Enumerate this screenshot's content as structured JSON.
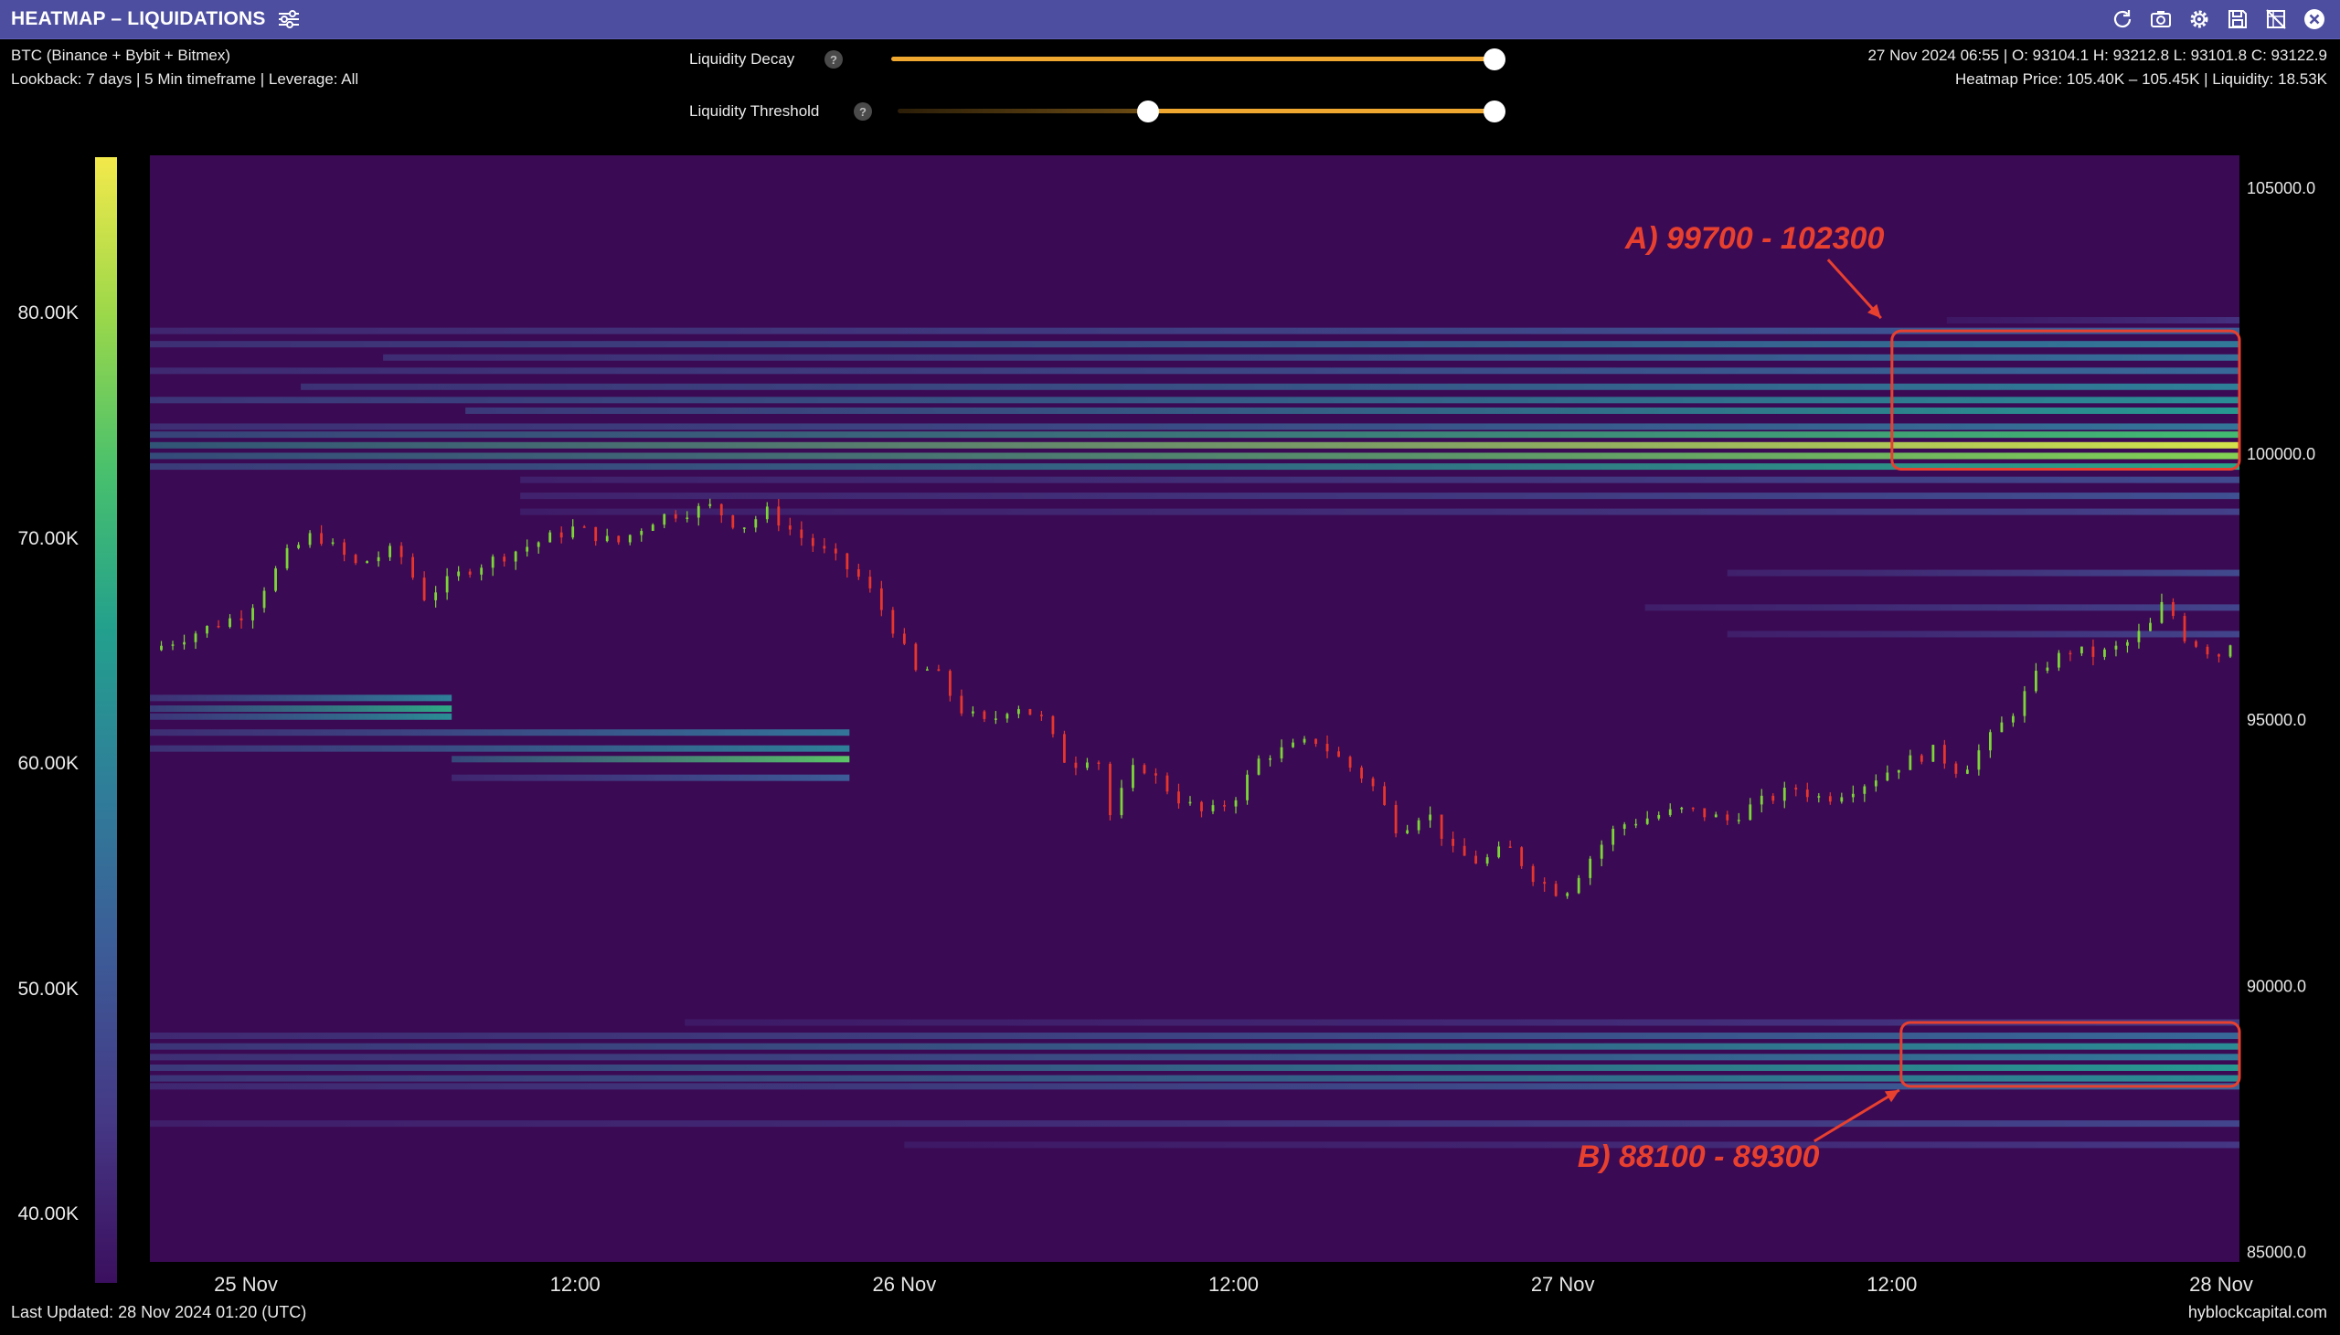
{
  "window": {
    "title": "HEATMAP – LIQUIDATIONS",
    "toolbar_icons": [
      "refresh-icon",
      "camera-icon",
      "gear-icon",
      "save-icon",
      "no-grid-icon",
      "close-icon"
    ],
    "accent_color": "#4d4ea0"
  },
  "info": {
    "exchanges": "BTC (Binance + Bybit + Bitmex)",
    "lookback": "Lookback: 7 days | 5 Min timeframe | Leverage: All",
    "ohlc": "27 Nov 2024 06:55 | O: 93104.1 H: 93212.8 L: 93101.8 C: 93122.9",
    "heatmap_info": "Heatmap Price: 105.40K – 105.45K | Liquidity: 18.53K"
  },
  "controls": {
    "decay": {
      "label": "Liquidity Decay",
      "help": "?",
      "value": 1.0
    },
    "threshold": {
      "label": "Liquidity Threshold",
      "help": "?",
      "range": [
        0.42,
        1.0
      ]
    }
  },
  "colorbar": {
    "ticks": [
      "80.00K",
      "70.00K",
      "60.00K",
      "50.00K",
      "40.00K"
    ],
    "tick_values": [
      80000,
      70000,
      60000,
      50000,
      40000
    ],
    "range": [
      37000,
      87000
    ]
  },
  "footer": {
    "last_updated": "Last Updated: 28 Nov 2024 01:20 (UTC)",
    "brand": "hyblockcapital.com"
  },
  "chart_data": {
    "type": "heatmap",
    "background_color": "#3b0a54",
    "ylim": [
      84800,
      105600
    ],
    "xlim": [
      "2024-11-24 20:30",
      "2024-11-28 00:40"
    ],
    "x_ticks": [
      "25 Nov",
      "12:00",
      "26 Nov",
      "12:00",
      "27 Nov",
      "12:00",
      "28 Nov"
    ],
    "x_tick_times": [
      "2024-11-25 00:00",
      "2024-11-25 12:00",
      "2024-11-26 00:00",
      "2024-11-26 12:00",
      "2024-11-27 00:00",
      "2024-11-27 12:00",
      "2024-11-28 00:00"
    ],
    "y_ticks": [
      "105000.0",
      "100000.0",
      "95000.0",
      "90000.0",
      "85000.0"
    ],
    "y_tick_values": [
      105000,
      100000,
      95000,
      90000,
      85000
    ],
    "liquidity_bands": [
      {
        "price": 102500,
        "start": "2024-11-27 14:00",
        "level": 0.12
      },
      {
        "price": 102300,
        "start": "2024-11-24 20:30",
        "level": 0.3
      },
      {
        "price": 102050,
        "start": "2024-11-24 20:30",
        "level": 0.42
      },
      {
        "price": 101800,
        "start": "2024-11-25 05:00",
        "level": 0.38
      },
      {
        "price": 101550,
        "start": "2024-11-24 20:30",
        "level": 0.35
      },
      {
        "price": 101250,
        "start": "2024-11-25 02:00",
        "level": 0.45
      },
      {
        "price": 101000,
        "start": "2024-11-24 20:30",
        "level": 0.5
      },
      {
        "price": 100800,
        "start": "2024-11-25 08:00",
        "level": 0.55
      },
      {
        "price": 100500,
        "start": "2024-11-24 20:30",
        "level": 0.4
      },
      {
        "price": 100350,
        "start": "2024-11-24 20:30",
        "level": 0.7
      },
      {
        "price": 100150,
        "start": "2024-11-24 20:30",
        "level": 0.95
      },
      {
        "price": 99950,
        "start": "2024-11-24 20:30",
        "level": 0.82
      },
      {
        "price": 99750,
        "start": "2024-11-24 20:30",
        "level": 0.6
      },
      {
        "price": 99500,
        "start": "2024-11-25 10:00",
        "level": 0.22
      },
      {
        "price": 99200,
        "start": "2024-11-25 10:00",
        "level": 0.25
      },
      {
        "price": 98900,
        "start": "2024-11-25 10:00",
        "level": 0.18
      },
      {
        "price": 97750,
        "start": "2024-11-27 06:00",
        "level": 0.22
      },
      {
        "price": 97100,
        "start": "2024-11-27 03:00",
        "level": 0.2
      },
      {
        "price": 96600,
        "start": "2024-11-27 06:00",
        "level": 0.2
      },
      {
        "price": 95400,
        "start": "2024-11-24 20:30",
        "end": "2024-11-25 07:30",
        "level": 0.45
      },
      {
        "price": 95200,
        "start": "2024-11-24 20:30",
        "end": "2024-11-25 07:30",
        "level": 0.62
      },
      {
        "price": 95050,
        "start": "2024-11-24 20:30",
        "end": "2024-11-25 07:30",
        "level": 0.5
      },
      {
        "price": 94750,
        "start": "2024-11-24 20:30",
        "end": "2024-11-25 22:00",
        "level": 0.4
      },
      {
        "price": 94450,
        "start": "2024-11-24 20:30",
        "end": "2024-11-25 22:00",
        "level": 0.45
      },
      {
        "price": 94250,
        "start": "2024-11-25 07:30",
        "end": "2024-11-25 22:00",
        "level": 0.75
      },
      {
        "price": 93900,
        "start": "2024-11-25 07:30",
        "end": "2024-11-25 22:00",
        "level": 0.3
      },
      {
        "price": 89300,
        "start": "2024-11-25 16:00",
        "level": 0.15
      },
      {
        "price": 89050,
        "start": "2024-11-24 20:30",
        "level": 0.35
      },
      {
        "price": 88850,
        "start": "2024-11-24 20:30",
        "level": 0.5
      },
      {
        "price": 88650,
        "start": "2024-11-24 20:30",
        "level": 0.42
      },
      {
        "price": 88450,
        "start": "2024-11-24 20:30",
        "level": 0.55
      },
      {
        "price": 88250,
        "start": "2024-11-24 20:30",
        "level": 0.5
      },
      {
        "price": 88100,
        "start": "2024-11-24 20:30",
        "level": 0.32
      },
      {
        "price": 87400,
        "start": "2024-11-24 20:30",
        "level": 0.2
      },
      {
        "price": 87000,
        "start": "2024-11-26 00:00",
        "level": 0.14
      }
    ],
    "price_series": [
      [
        "2024-11-24 20:30",
        96300
      ],
      [
        "2024-11-24 22:00",
        96600
      ],
      [
        "2024-11-25 00:00",
        97000
      ],
      [
        "2024-11-25 01:30",
        98100
      ],
      [
        "2024-11-25 02:30",
        98500
      ],
      [
        "2024-11-25 04:00",
        97900
      ],
      [
        "2024-11-25 05:30",
        98200
      ],
      [
        "2024-11-25 06:30",
        97300
      ],
      [
        "2024-11-25 08:00",
        97800
      ],
      [
        "2024-11-25 10:00",
        98200
      ],
      [
        "2024-11-25 12:00",
        98600
      ],
      [
        "2024-11-25 13:30",
        98300
      ],
      [
        "2024-11-25 15:00",
        98800
      ],
      [
        "2024-11-25 17:00",
        99000
      ],
      [
        "2024-11-25 18:00",
        98600
      ],
      [
        "2024-11-25 19:00",
        98900
      ],
      [
        "2024-11-25 20:00",
        98500
      ],
      [
        "2024-11-25 21:30",
        98000
      ],
      [
        "2024-11-25 22:30",
        97600
      ],
      [
        "2024-11-25 23:30",
        96800
      ],
      [
        "2024-11-26 00:30",
        95800
      ],
      [
        "2024-11-26 01:00",
        96000
      ],
      [
        "2024-11-26 02:00",
        95200
      ],
      [
        "2024-11-26 03:00",
        94900
      ],
      [
        "2024-11-26 04:00",
        95300
      ],
      [
        "2024-11-26 05:00",
        95000
      ],
      [
        "2024-11-26 06:00",
        94100
      ],
      [
        "2024-11-26 07:00",
        94400
      ],
      [
        "2024-11-26 07:30",
        93200
      ],
      [
        "2024-11-26 08:30",
        94200
      ],
      [
        "2024-11-26 10:00",
        93500
      ],
      [
        "2024-11-26 11:00",
        93200
      ],
      [
        "2024-11-26 12:00",
        93500
      ],
      [
        "2024-11-26 13:00",
        94300
      ],
      [
        "2024-11-26 15:00",
        94600
      ],
      [
        "2024-11-26 16:00",
        94200
      ],
      [
        "2024-11-26 17:00",
        93800
      ],
      [
        "2024-11-26 18:00",
        92900
      ],
      [
        "2024-11-26 19:00",
        93300
      ],
      [
        "2024-11-26 20:00",
        92500
      ],
      [
        "2024-11-26 21:00",
        92300
      ],
      [
        "2024-11-26 22:00",
        92600
      ],
      [
        "2024-11-26 23:00",
        92000
      ],
      [
        "2024-11-27 00:00",
        91700
      ],
      [
        "2024-11-27 01:00",
        92400
      ],
      [
        "2024-11-27 02:00",
        93000
      ],
      [
        "2024-11-27 03:30",
        93200
      ],
      [
        "2024-11-27 04:30",
        93300
      ],
      [
        "2024-11-27 06:00",
        93100
      ],
      [
        "2024-11-27 07:00",
        93400
      ],
      [
        "2024-11-27 08:30",
        93700
      ],
      [
        "2024-11-27 09:30",
        93500
      ],
      [
        "2024-11-27 11:00",
        93800
      ],
      [
        "2024-11-27 12:30",
        94200
      ],
      [
        "2024-11-27 13:30",
        94400
      ],
      [
        "2024-11-27 14:30",
        94000
      ],
      [
        "2024-11-27 15:30",
        94600
      ],
      [
        "2024-11-27 16:30",
        95200
      ],
      [
        "2024-11-27 17:30",
        96000
      ],
      [
        "2024-11-27 18:30",
        96300
      ],
      [
        "2024-11-27 19:30",
        96200
      ],
      [
        "2024-11-27 20:30",
        96400
      ],
      [
        "2024-11-27 21:30",
        96800
      ],
      [
        "2024-11-27 22:00",
        97300
      ],
      [
        "2024-11-27 22:30",
        96600
      ],
      [
        "2024-11-27 23:30",
        96300
      ],
      [
        "2024-11-28 00:00",
        96200
      ],
      [
        "2024-11-28 00:30",
        96600
      ],
      [
        "2024-11-28 00:40",
        96500
      ]
    ],
    "annotations": [
      {
        "label": "A) 99700 - 102300",
        "price_range": [
          99700,
          102300
        ],
        "time_range": [
          "2024-11-27 12:00",
          "2024-11-28 00:40"
        ]
      },
      {
        "label": "B) 88100 - 89300",
        "price_range": [
          88100,
          89300
        ],
        "time_range": [
          "2024-11-27 12:20",
          "2024-11-28 00:40"
        ]
      }
    ],
    "annotation_color": "#e8402f",
    "bull_color": "#7cd638",
    "bear_color": "#e7362b"
  }
}
